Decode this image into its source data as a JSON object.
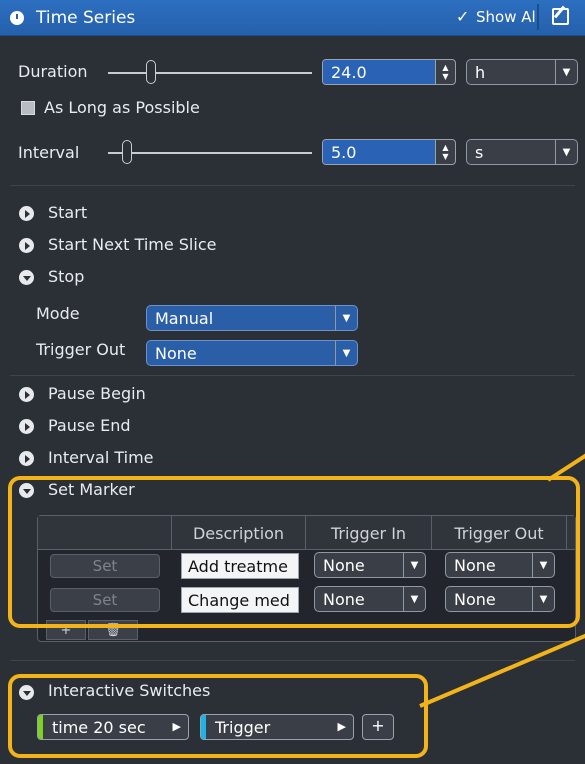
{
  "header": {
    "title": "Time Series",
    "show_all": "Show All",
    "check_glyph": "✓"
  },
  "duration": {
    "label": "Duration",
    "value": "24.0",
    "unit": "h"
  },
  "as_long": {
    "label": "As Long as Possible",
    "checked": true
  },
  "interval": {
    "label": "Interval",
    "value": "5.0",
    "unit": "s"
  },
  "sections": {
    "start": "Start",
    "start_next": "Start Next Time Slice",
    "stop": "Stop",
    "pause_begin": "Pause Begin",
    "pause_end": "Pause End",
    "interval_time": "Interval Time",
    "set_marker": "Set Marker",
    "interactive": "Interactive Switches"
  },
  "stop": {
    "mode_label": "Mode",
    "mode_value": "Manual",
    "trigger_out_label": "Trigger Out",
    "trigger_out_value": "None"
  },
  "marker_table": {
    "headers": [
      "",
      "Description",
      "Trigger In",
      "Trigger Out"
    ],
    "rows": [
      {
        "button": "Set",
        "description": "Add treatme",
        "trigger_in": "None",
        "trigger_out": "None"
      },
      {
        "button": "Set",
        "description": "Change med",
        "trigger_in": "None",
        "trigger_out": "None"
      }
    ],
    "add_label": "+",
    "delete_label": "🗑"
  },
  "switches": [
    {
      "label": "time 20 sec",
      "color": "#7ed321"
    },
    {
      "label": "Trigger",
      "color": "#1fb3e8"
    }
  ],
  "switch_add": "+",
  "colors": {
    "header": "#2560ab",
    "background": "#2b2f36",
    "highlight": "#f2b31b"
  }
}
